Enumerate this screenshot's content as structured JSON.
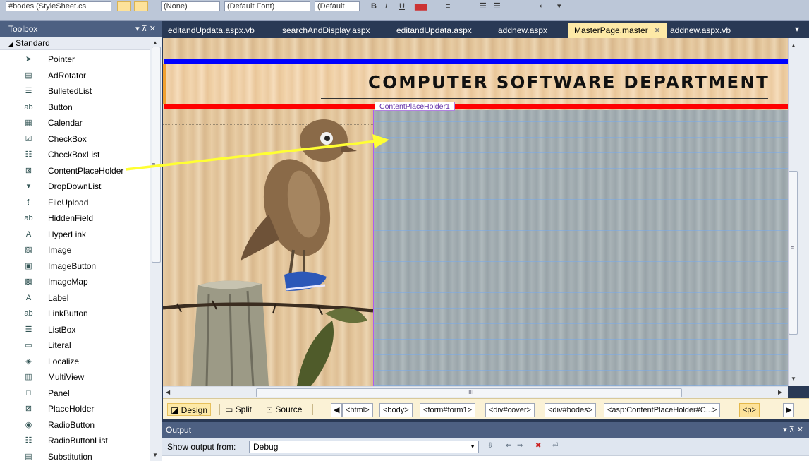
{
  "toolbar": {
    "style_target": "#bodes (StyleSheet.cs",
    "style_none": "(None)",
    "font": "(Default Font)",
    "size": "(Default"
  },
  "toolbox": {
    "title": "Toolbox",
    "pins": "▾ ⊼ ✕",
    "category": "Standard",
    "items": [
      {
        "label": "Pointer",
        "icon": "pointer-icon"
      },
      {
        "label": "AdRotator",
        "icon": "adrotator-icon"
      },
      {
        "label": "BulletedList",
        "icon": "bulleted-list-icon"
      },
      {
        "label": "Button",
        "icon": "button-icon"
      },
      {
        "label": "Calendar",
        "icon": "calendar-icon"
      },
      {
        "label": "CheckBox",
        "icon": "checkbox-icon"
      },
      {
        "label": "CheckBoxList",
        "icon": "checkbox-list-icon"
      },
      {
        "label": "ContentPlaceHolder",
        "icon": "content-placeholder-icon"
      },
      {
        "label": "DropDownList",
        "icon": "dropdown-list-icon"
      },
      {
        "label": "FileUpload",
        "icon": "file-upload-icon"
      },
      {
        "label": "HiddenField",
        "icon": "hidden-field-icon"
      },
      {
        "label": "HyperLink",
        "icon": "hyperlink-icon"
      },
      {
        "label": "Image",
        "icon": "image-icon"
      },
      {
        "label": "ImageButton",
        "icon": "image-button-icon"
      },
      {
        "label": "ImageMap",
        "icon": "image-map-icon"
      },
      {
        "label": "Label",
        "icon": "label-icon"
      },
      {
        "label": "LinkButton",
        "icon": "link-button-icon"
      },
      {
        "label": "ListBox",
        "icon": "listbox-icon"
      },
      {
        "label": "Literal",
        "icon": "literal-icon"
      },
      {
        "label": "Localize",
        "icon": "localize-icon"
      },
      {
        "label": "MultiView",
        "icon": "multiview-icon"
      },
      {
        "label": "Panel",
        "icon": "panel-icon"
      },
      {
        "label": "PlaceHolder",
        "icon": "placeholder-icon"
      },
      {
        "label": "RadioButton",
        "icon": "radio-button-icon"
      },
      {
        "label": "RadioButtonList",
        "icon": "radio-button-list-icon"
      },
      {
        "label": "Substitution",
        "icon": "substitution-icon"
      }
    ]
  },
  "tabs": [
    {
      "label": "editandUpdata.aspx.vb"
    },
    {
      "label": "searchAndDisplay.aspx"
    },
    {
      "label": "editandUpdata.aspx"
    },
    {
      "label": "addnew.aspx"
    },
    {
      "label": "MasterPage.master",
      "active": true
    },
    {
      "label": "addnew.aspx.vb"
    }
  ],
  "design": {
    "page_title": "COMPUTER SOFTWARE DEPARTMENT",
    "placeholder_tag": "ContentPlaceHolder1"
  },
  "viewbar": {
    "design": "Design",
    "split": "Split",
    "source": "Source",
    "crumbs": [
      "<html>",
      "<body>",
      "<form#form1>",
      "<div#cover>",
      "<div#bodes>",
      "<asp:ContentPlaceHolder#C...>",
      "<p>"
    ]
  },
  "output": {
    "title": "Output",
    "pins": "▾ ⊼ ✕",
    "show_from_label": "Show output from:",
    "show_from_value": "Debug"
  },
  "colors": {
    "ide_blue": "#293955",
    "active_tab": "#fde9a7",
    "blue_rule": "#0000ff",
    "red_rule": "#ff0000",
    "placeholder_border": "#b05cf0",
    "annotation_arrow": "#ffff33"
  }
}
